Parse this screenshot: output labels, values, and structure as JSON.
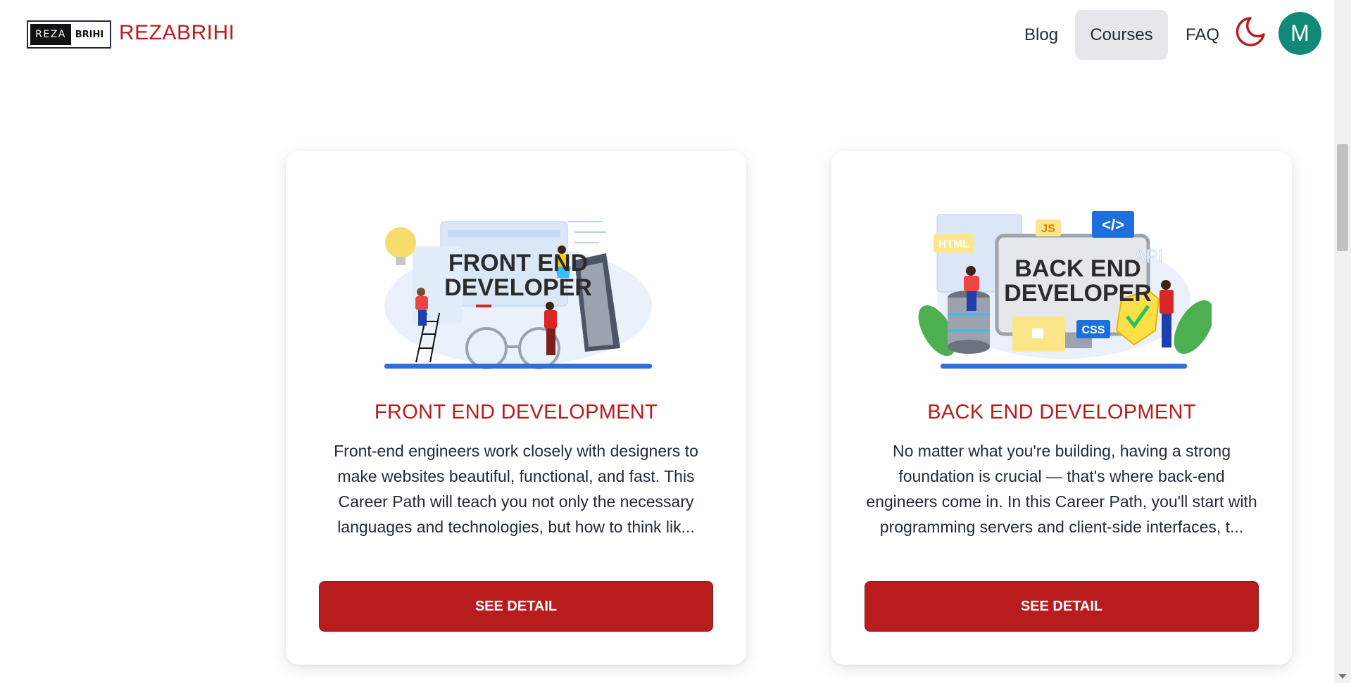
{
  "header": {
    "logo": {
      "left": "REZA",
      "right": "BRIHI"
    },
    "brand": "REZABRIHI",
    "nav": [
      {
        "label": "Blog"
      },
      {
        "label": "Courses",
        "active": true
      },
      {
        "label": "FAQ"
      }
    ],
    "theme_toggle_icon": "moon-icon",
    "avatar_initial": "M"
  },
  "colors": {
    "accent": "#b91c1c",
    "avatar": "#0f8a77",
    "active_nav_bg": "#e5e7eb"
  },
  "courses": [
    {
      "illustration": {
        "line1": "FRONT END",
        "line2": "DEVELOPER"
      },
      "title": "FRONT END DEVELOPMENT",
      "description": "Front-end engineers work closely with designers to make websites beautiful, functional, and fast. This Career Path will teach you not only the necessary languages and technologies, but how to think lik...",
      "button": "SEE DETAIL"
    },
    {
      "illustration": {
        "line1": "BACK END",
        "line2": "DEVELOPER",
        "tags": [
          "JS",
          "</>",
          "HTML",
          "API",
          "CSS"
        ]
      },
      "title": "BACK END DEVELOPMENT",
      "description": "No matter what you're building, having a strong foundation is crucial — that's where back-end engineers come in. In this Career Path, you'll start with programming servers and client-side interfaces, t...",
      "button": "SEE DETAIL"
    }
  ]
}
